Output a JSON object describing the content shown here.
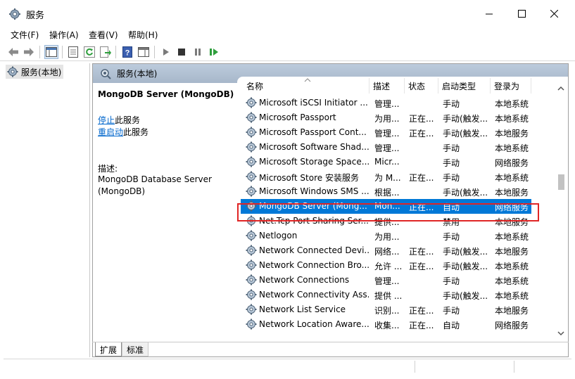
{
  "window": {
    "title": "服务",
    "menu": [
      "文件(F)",
      "操作(A)",
      "查看(V)",
      "帮助(H)"
    ]
  },
  "tree": {
    "root_label": "服务(本地)"
  },
  "content": {
    "header_label": "服务(本地)",
    "selected_service_title": "MongoDB Server (MongoDB)",
    "stop_link": "停止",
    "stop_suffix": "此服务",
    "restart_link": "重启动",
    "restart_suffix": "此服务",
    "description_label": "描述:",
    "description_text": "MongoDB Database Server (MongoDB)"
  },
  "columns": [
    "名称",
    "描述",
    "状态",
    "启动类型",
    "登录为"
  ],
  "services": [
    {
      "name": "Microsoft iSCSI Initiator ...",
      "desc": "管理...",
      "status": "",
      "startup": "手动",
      "logon": "本地系统"
    },
    {
      "name": "Microsoft Passport",
      "desc": "为用...",
      "status": "正在...",
      "startup": "手动(触发...",
      "logon": "本地系统"
    },
    {
      "name": "Microsoft Passport Cont...",
      "desc": "管理...",
      "status": "正在...",
      "startup": "手动(触发...",
      "logon": "本地服务"
    },
    {
      "name": "Microsoft Software Shad...",
      "desc": "管理...",
      "status": "",
      "startup": "手动",
      "logon": "本地系统"
    },
    {
      "name": "Microsoft Storage Space...",
      "desc": "Micr...",
      "status": "",
      "startup": "手动",
      "logon": "网络服务"
    },
    {
      "name": "Microsoft Store 安装服务",
      "desc": "为 M...",
      "status": "正在...",
      "startup": "手动",
      "logon": "本地系统"
    },
    {
      "name": "Microsoft Windows SMS ...",
      "desc": "根据...",
      "status": "",
      "startup": "手动(触发...",
      "logon": "本地服务"
    },
    {
      "name": "MongoDB Server (Mong...",
      "desc": "Mon...",
      "status": "正在...",
      "startup": "自动",
      "logon": "网络服务",
      "selected": true
    },
    {
      "name": "Net.Tcp Port Sharing Ser...",
      "desc": "提供...",
      "status": "",
      "startup": "禁用",
      "logon": "本地服务"
    },
    {
      "name": "Netlogon",
      "desc": "为用...",
      "status": "",
      "startup": "手动",
      "logon": "本地系统"
    },
    {
      "name": "Network Connected Devi...",
      "desc": "网络...",
      "status": "正在...",
      "startup": "手动(触发...",
      "logon": "本地服务"
    },
    {
      "name": "Network Connection Bro...",
      "desc": "允许 ...",
      "status": "正在...",
      "startup": "手动(触发...",
      "logon": "本地系统"
    },
    {
      "name": "Network Connections",
      "desc": "管理...",
      "status": "",
      "startup": "手动",
      "logon": "本地系统"
    },
    {
      "name": "Network Connectivity Ass...",
      "desc": "提供 ...",
      "status": "",
      "startup": "手动(触发...",
      "logon": "本地系统"
    },
    {
      "name": "Network List Service",
      "desc": "识别...",
      "status": "正在...",
      "startup": "手动",
      "logon": "本地服务"
    },
    {
      "name": "Network Location Aware...",
      "desc": "收集...",
      "status": "正在...",
      "startup": "自动",
      "logon": "网络服务"
    }
  ],
  "tabs": [
    "扩展",
    "标准"
  ],
  "colors": {
    "selection": "#0078d7",
    "highlight_box": "#e02525",
    "header_gradient": "#b3c3d6",
    "link": "#0066cc"
  }
}
